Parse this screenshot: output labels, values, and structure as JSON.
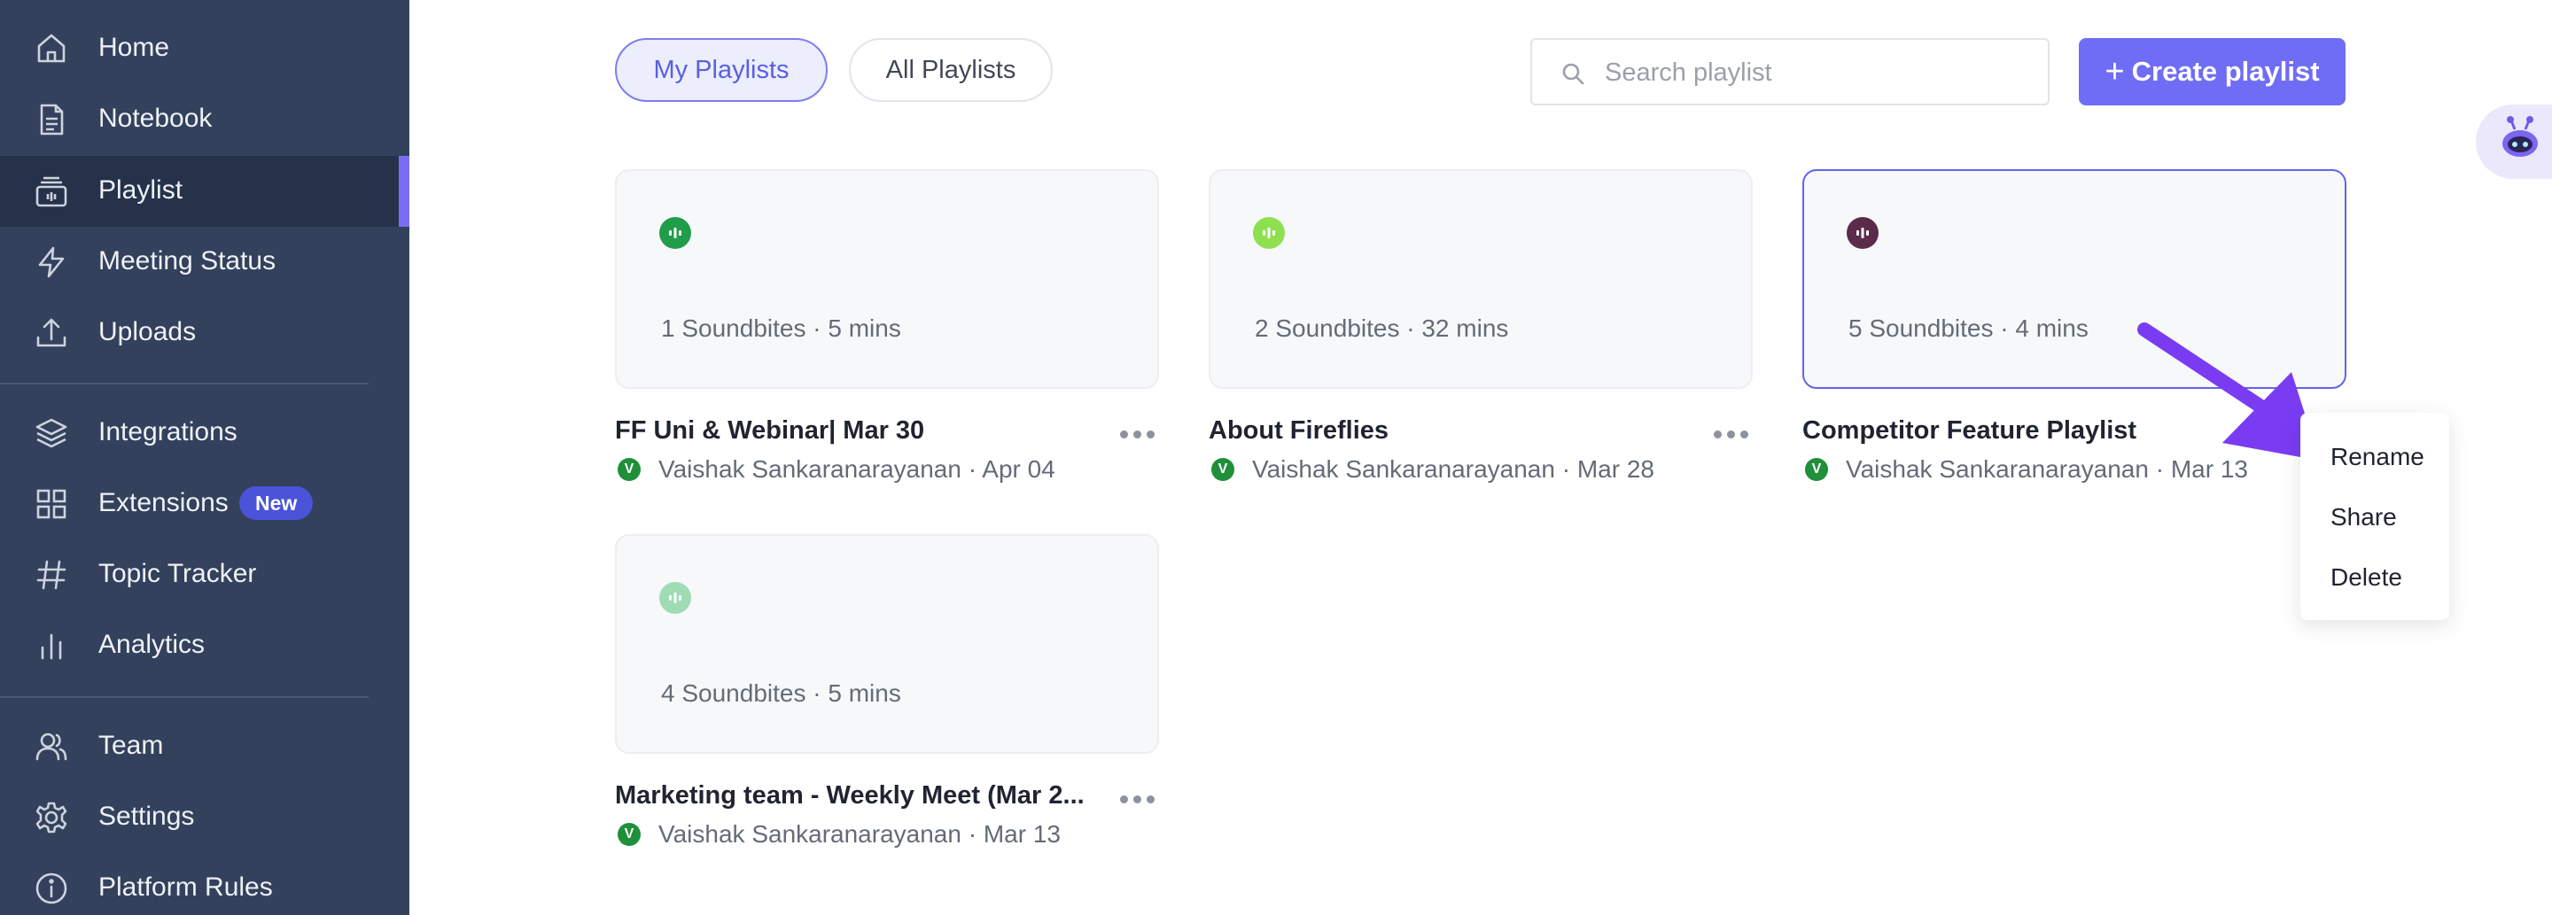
{
  "sidebar": {
    "items": [
      {
        "label": "Home",
        "icon": "home-icon"
      },
      {
        "label": "Notebook",
        "icon": "notebook-icon"
      },
      {
        "label": "Playlist",
        "icon": "playlist-icon",
        "active": true
      },
      {
        "label": "Meeting Status",
        "icon": "lightning-icon"
      },
      {
        "label": "Uploads",
        "icon": "upload-icon"
      },
      {
        "label": "Integrations",
        "icon": "layers-icon"
      },
      {
        "label": "Extensions",
        "icon": "grid-icon",
        "badge": "New"
      },
      {
        "label": "Topic Tracker",
        "icon": "hashtag-icon"
      },
      {
        "label": "Analytics",
        "icon": "bar-chart-icon"
      },
      {
        "label": "Team",
        "icon": "team-icon"
      },
      {
        "label": "Settings",
        "icon": "gear-icon"
      },
      {
        "label": "Platform Rules",
        "icon": "info-icon"
      }
    ]
  },
  "toolbar": {
    "tabs": [
      {
        "label": "My Playlists",
        "active": true
      },
      {
        "label": "All Playlists",
        "active": false
      }
    ],
    "search_placeholder": "Search playlist",
    "search_value": "",
    "create_label": "Create playlist"
  },
  "playlists": [
    {
      "meta": "1 Soundbites · 5 mins",
      "title": "FF Uni & Webinar| Mar 30",
      "owner": "Vaishak Sankaranarayanan · Apr 04",
      "avatar": "V",
      "icon_color": "#1f9d4a"
    },
    {
      "meta": "2 Soundbites · 32 mins",
      "title": "About Fireflies",
      "owner": "Vaishak Sankaranarayanan · Mar 28",
      "avatar": "V",
      "icon_color": "#8ee04f"
    },
    {
      "meta": "5 Soundbites · 4 mins",
      "title": "Competitor Feature Playlist",
      "owner": "Vaishak Sankaranarayanan · Mar 13",
      "avatar": "V",
      "icon_color": "#5c2a4a",
      "selected": true
    },
    {
      "meta": "4 Soundbites · 5 mins",
      "title": "Marketing team - Weekly Meet (Mar 2...",
      "owner": "Vaishak Sankaranarayanan · Mar 13",
      "avatar": "V",
      "icon_color": "#9fdcb4"
    }
  ],
  "context_menu": {
    "items": [
      "Rename",
      "Share",
      "Delete"
    ]
  },
  "colors": {
    "sidebar_bg": "#33415c",
    "accent": "#6f6df5",
    "annotation_arrow": "#7a3cf2"
  }
}
